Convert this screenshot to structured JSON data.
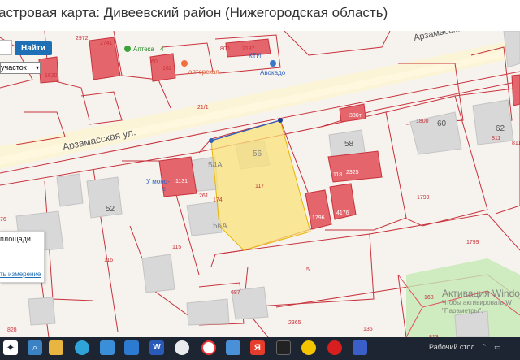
{
  "page": {
    "title": "астровая карта: Дивеевский район (Нижегородская область)"
  },
  "search": {
    "value": "",
    "button_label": "Найти"
  },
  "type_select": {
    "selected": "участок"
  },
  "map": {
    "street_label": "Арзамасская ул.",
    "street_label_2": "Арзамасская",
    "poi": {
      "pharmacy": "Аптека",
      "pharmacy_extra": "4",
      "avokado": "Авокадо",
      "store": "аптерская",
      "kti": "КТИ"
    },
    "place_label": "У моно-",
    "place_label_2": "с",
    "parcel_labels": [
      "2972",
      "2741",
      "60",
      "162",
      "800",
      "2187",
      "1620",
      "21/1",
      "1800",
      "60",
      "62",
      "811",
      "811",
      "58",
      "386т",
      "56",
      "54А",
      "117",
      "261",
      "1131",
      "118",
      "2325",
      "174",
      "52",
      "56А",
      "1796",
      "4176",
      "1799",
      "1799",
      "116",
      "115",
      "5",
      "687",
      "168",
      "2365",
      "828",
      "135",
      "813",
      "76"
    ],
    "house_labels": [
      "52",
      "58",
      "60",
      "56",
      "54А",
      "56А",
      "62"
    ]
  },
  "measure_panel": {
    "area_label": "площади",
    "new_measure_link": "ть измерение"
  },
  "watermark": {
    "line1": "Активация Windo",
    "line2": "Чтобы активировать W",
    "line3": "\"Параметры\"."
  },
  "taskbar": {
    "icons": [
      "start-icon",
      "search-icon",
      "task-view-icon",
      "file-explorer-icon",
      "edge-icon",
      "store-icon",
      "word-icon",
      "chrome-icon",
      "yandex-browser-icon",
      "calculator-icon",
      "yandex-icon",
      "shield-icon",
      "beeline-icon",
      "opera-icon",
      "app-icon"
    ],
    "desktop_label": "Рабочий стол"
  }
}
